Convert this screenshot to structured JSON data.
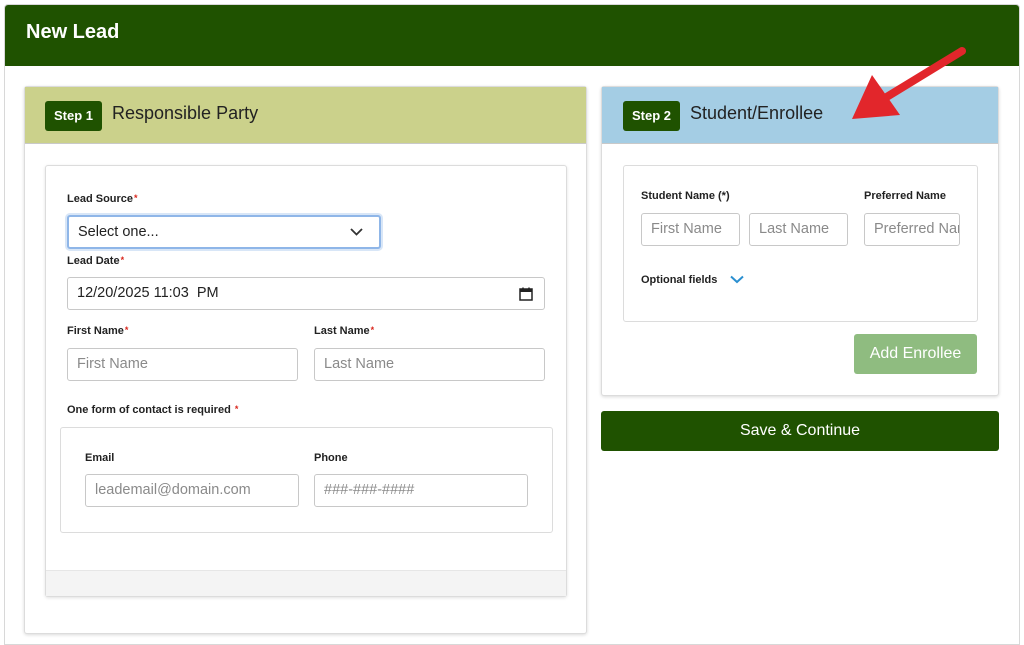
{
  "modal": {
    "title": "New Lead"
  },
  "step1": {
    "badge": "Step 1",
    "title": "Responsible Party",
    "lead_source": {
      "label": "Lead Source",
      "value": "Select one..."
    },
    "lead_date": {
      "label": "Lead Date",
      "value": "12/20/2025 11:03  PM"
    },
    "first_name": {
      "label": "First Name",
      "placeholder": "First Name"
    },
    "last_name": {
      "label": "Last Name",
      "placeholder": "Last Name"
    },
    "contact_note": "One form of contact is required",
    "email": {
      "label": "Email",
      "placeholder": "leademail@domain.com"
    },
    "phone": {
      "label": "Phone",
      "placeholder": "###-###-####"
    }
  },
  "step2": {
    "badge": "Step 2",
    "title": "Student/Enrollee",
    "student_name_label": "Student Name (*)",
    "preferred_name_label": "Preferred Name",
    "first_name_placeholder": "First Name",
    "last_name_placeholder": "Last Name",
    "preferred_placeholder": "Preferred Name",
    "optional_fields": "Optional fields",
    "add_button": "Add Enrollee"
  },
  "save_button": "Save & Continue",
  "required_mark": "*",
  "colors": {
    "header": "#1f5200",
    "step1_header": "#cbd18b",
    "step2_header": "#a4cde4",
    "add_button": "#8fbc80",
    "arrow": "#e2262b"
  }
}
